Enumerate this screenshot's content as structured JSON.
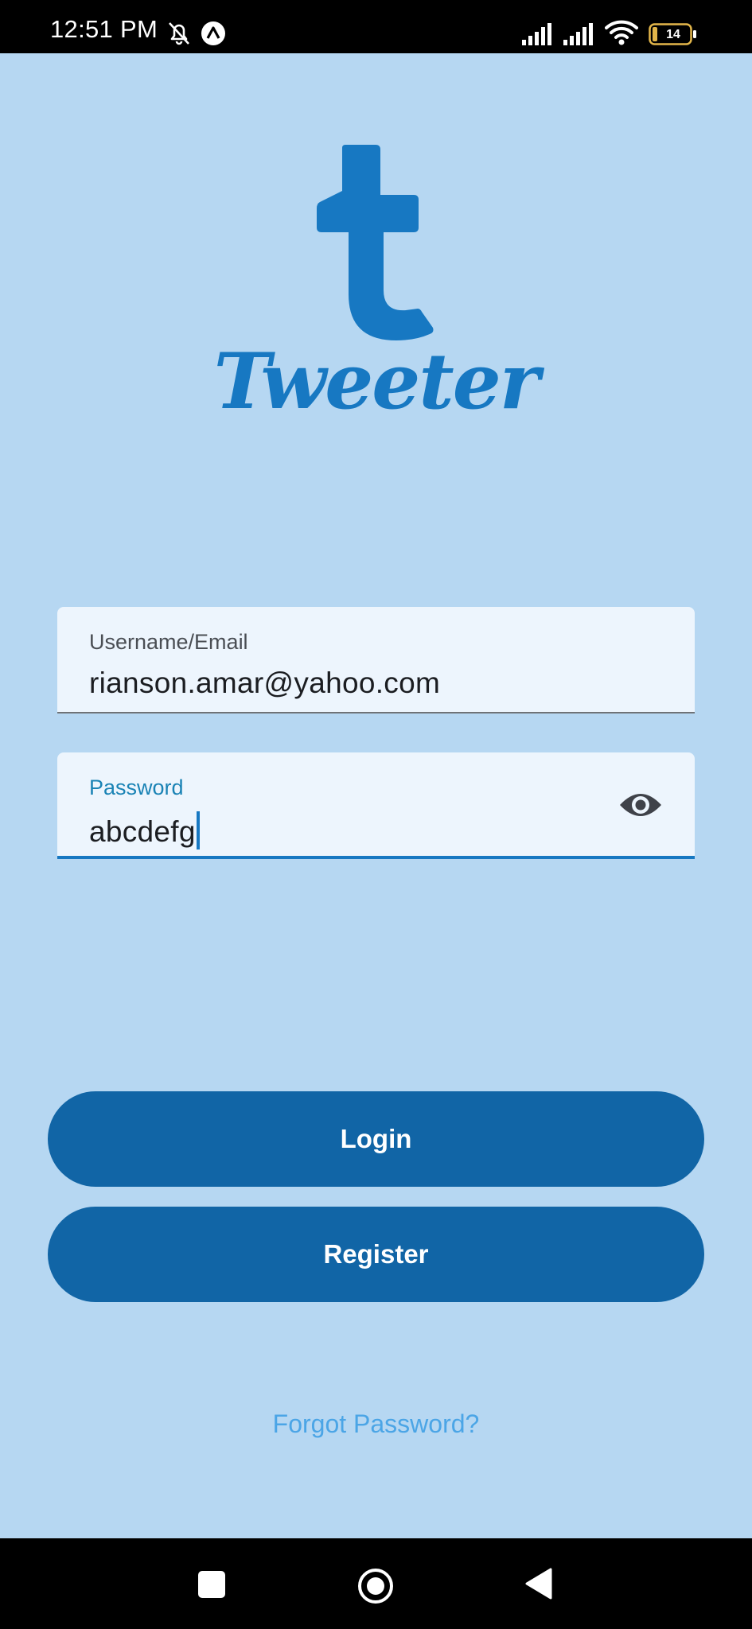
{
  "status_bar": {
    "time": "12:51 PM",
    "battery_level": "14",
    "icons": [
      "bell-off-icon",
      "app-notification-icon",
      "signal-icon",
      "signal-icon",
      "wifi-icon",
      "battery-icon"
    ]
  },
  "app": {
    "name": "Tweeter",
    "logo_letter": "t",
    "brand_color": "#1778c2"
  },
  "login_form": {
    "username": {
      "label": "Username/Email",
      "value": "rianson.amar@yahoo.com"
    },
    "password": {
      "label": "Password",
      "value": "abcdefg",
      "toggle_icon": "eye-icon"
    }
  },
  "buttons": {
    "login": "Login",
    "register": "Register",
    "forgot_password": "Forgot Password?"
  },
  "colors": {
    "background": "#b6d7f2",
    "button": "#1165a6",
    "link": "#4ba5e6"
  },
  "nav_bar": {
    "icons": [
      "recent-apps-icon",
      "home-icon",
      "back-icon"
    ]
  }
}
